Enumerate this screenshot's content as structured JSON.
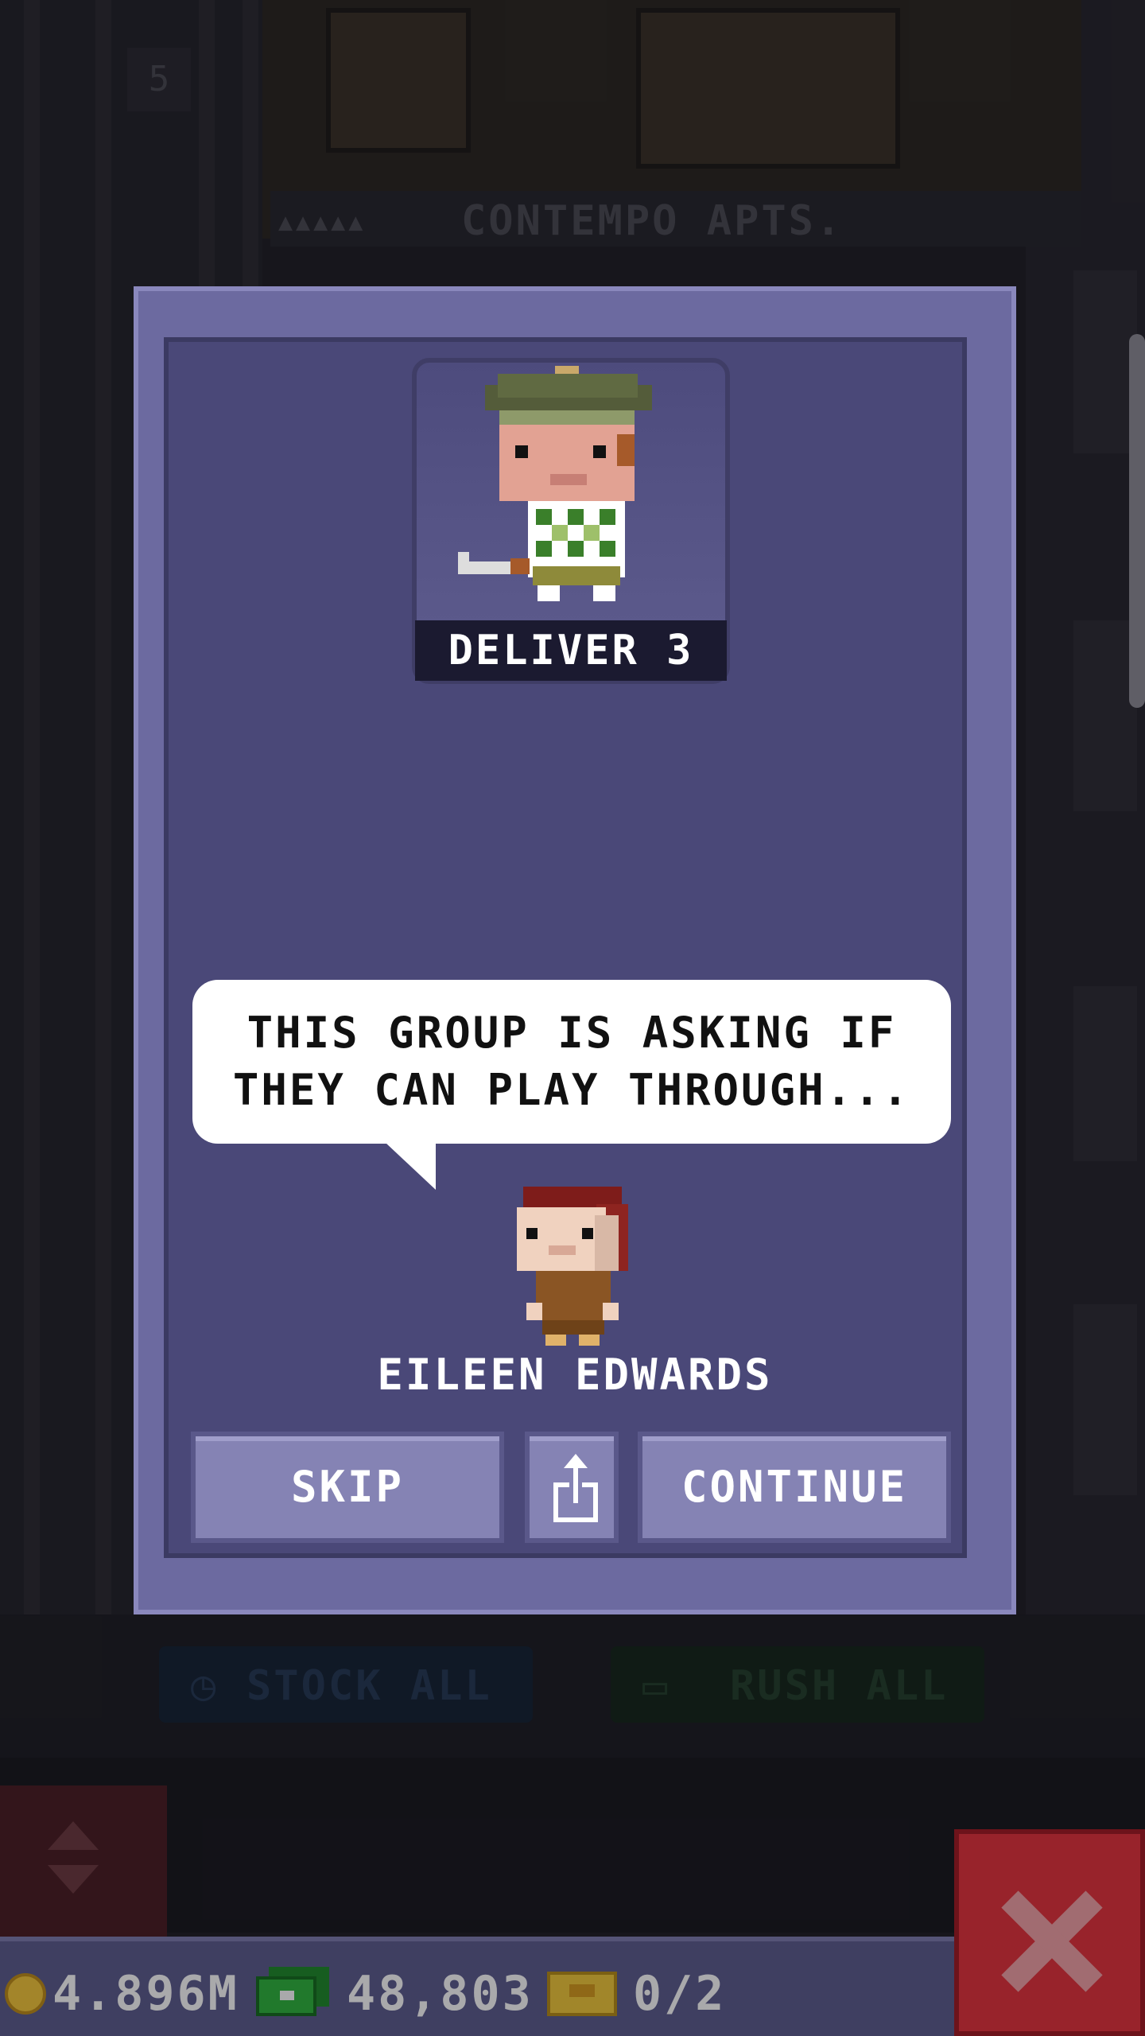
{
  "background": {
    "floor_number": "5",
    "floor_name": "CONTEMPO APTS.",
    "floor_occupancy": "▲▲▲▲▲",
    "stock_all_label": "STOCK ALL",
    "rush_all_label": "RUSH ALL"
  },
  "mission": {
    "task_label": "DELIVER 3",
    "speech_lines": [
      "THIS GROUP IS ASKING IF",
      "THEY CAN PLAY THROUGH..."
    ],
    "npc_name": "EILEEN EDWARDS",
    "skip_label": "SKIP",
    "continue_label": "CONTINUE",
    "share_icon": "share-icon"
  },
  "status_bar": {
    "coins": "4.896M",
    "bux": "48,803",
    "vip_tickets": "0/2"
  },
  "colors": {
    "modal_frame": "#6c6aa0",
    "modal_inner": "#4a4878",
    "button": "#8583b4",
    "close_button": "#e5323b",
    "status_bar": "#5d5c8e"
  }
}
